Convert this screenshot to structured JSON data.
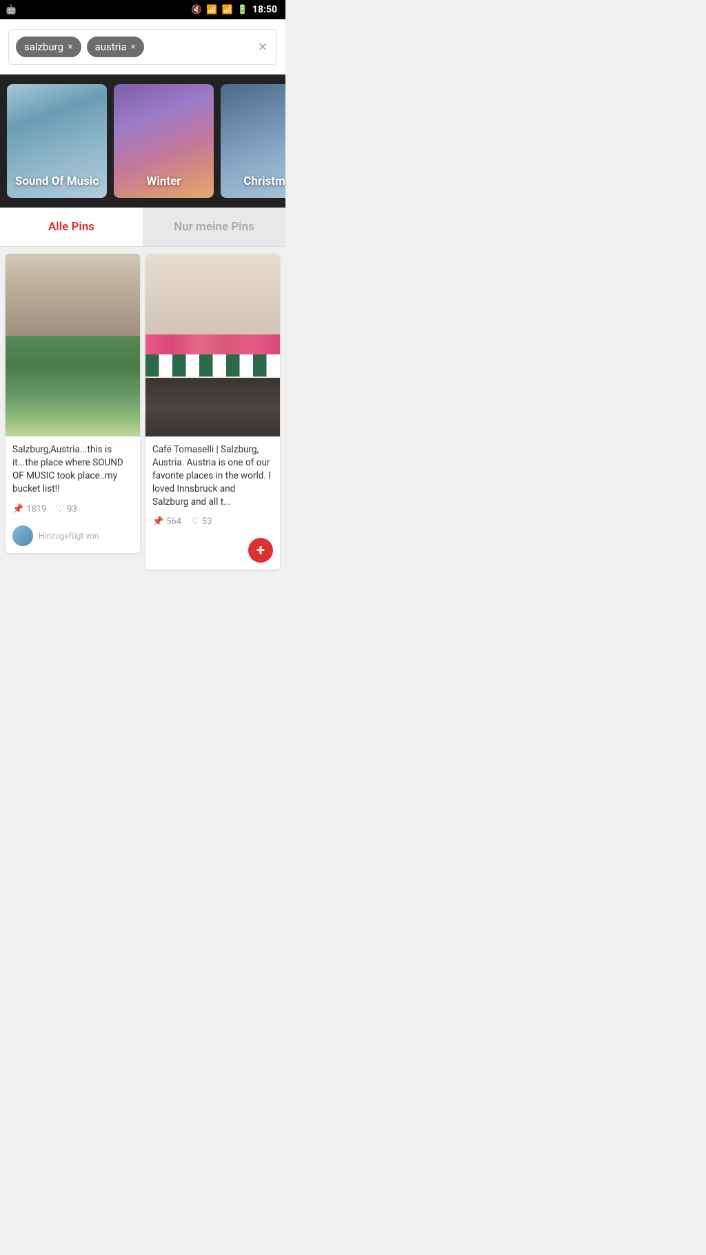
{
  "statusBar": {
    "time": "18:50",
    "appIcon": "🤖"
  },
  "search": {
    "tags": [
      {
        "label": "salzburg",
        "id": "tag-salzburg"
      },
      {
        "label": "austria",
        "id": "tag-austria"
      }
    ],
    "clearLabel": "×"
  },
  "categories": [
    {
      "id": "sound-of-music",
      "label": "Sound Of Music",
      "cssClass": "cat-sound"
    },
    {
      "id": "winter",
      "label": "Winter",
      "cssClass": "cat-winter"
    },
    {
      "id": "christmas",
      "label": "Christmas",
      "cssClass": "cat-christmas"
    }
  ],
  "tabs": [
    {
      "id": "alle-pins",
      "label": "Alle Pins",
      "active": true
    },
    {
      "id": "nur-meine-pins",
      "label": "Nur meine Pins",
      "active": false
    }
  ],
  "pins": [
    {
      "id": "pin-salzburg",
      "text": "Salzburg,Austria...this is it...the place where SOUND OF MUSIC took place..my bucket list!!",
      "repins": "1819",
      "likes": "93",
      "addedBy": "Hinzugefügt von"
    },
    {
      "id": "pin-cafe",
      "text": "Café Tomaselli | Salzburg, Austria. Austria is one of our favorite places in the world.  I loved Innsbruck and Salzburg and all t...",
      "repins": "564",
      "likes": "53",
      "addedBy": ""
    }
  ]
}
